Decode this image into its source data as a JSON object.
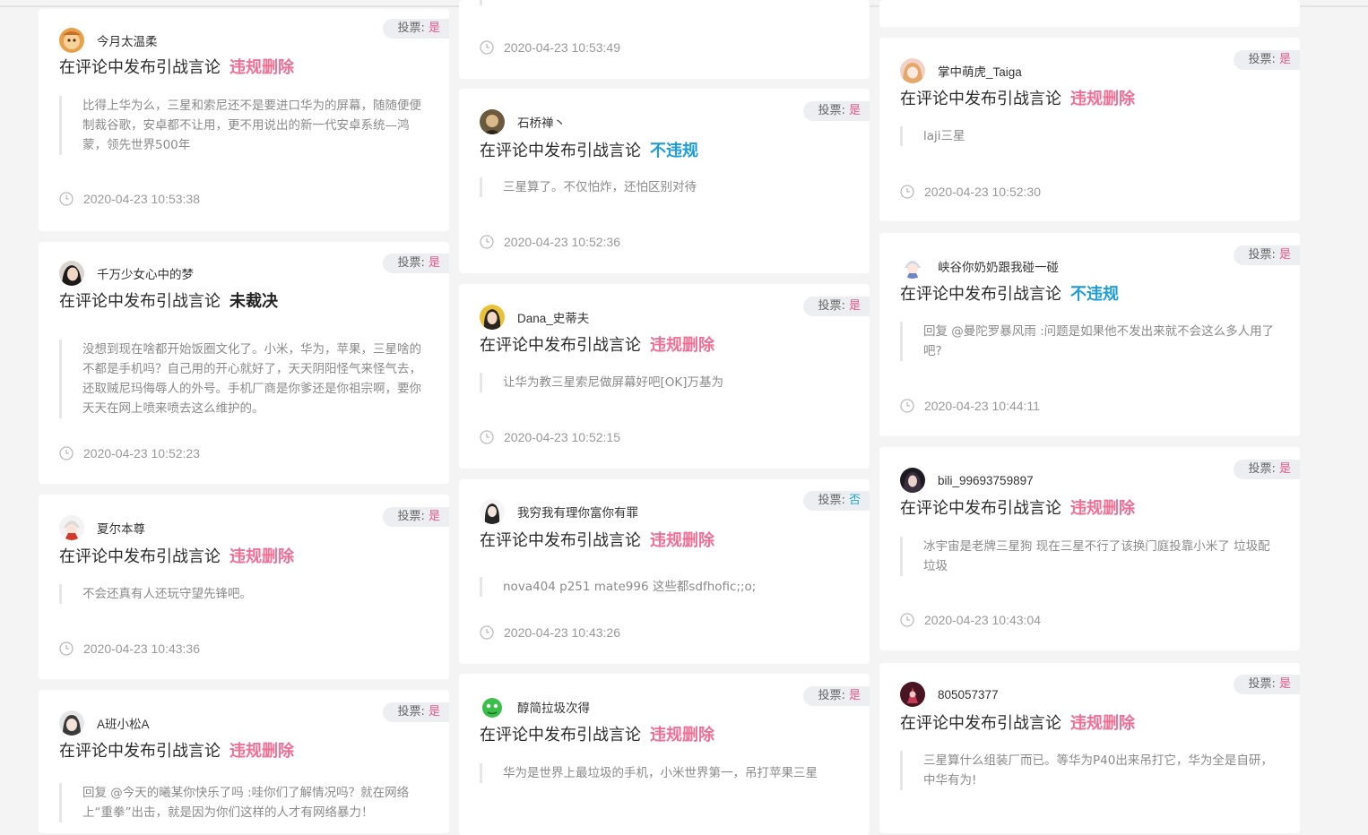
{
  "vote_label": "投票:",
  "title_text": "在评论中发布引战言论",
  "col1": [
    {
      "user": "今月太温柔",
      "vote": "是",
      "verdict": "违规删除",
      "quote": "比得上华为么，三星和索尼还不是要进口华为的屏幕，随随便便制裁谷歌，安卓都不让用，更不用说出的新一代安卓系统—鸿蒙，领先世界500年",
      "time": "2020-04-23 10:53:38"
    },
    {
      "user": "千万少女心中的梦",
      "vote": "是",
      "verdict": "未裁决",
      "quote": "没想到现在啥都开始饭圈文化了。小米，华为，苹果，三星啥的不都是手机吗？自己用的开心就好了，天天阴阳怪气来怪气去，还取贼尼玛侮辱人的外号。手机厂商是你爹还是你祖宗啊，要你天天在网上喷来喷去这么维护的。",
      "time": "2020-04-23 10:52:23"
    },
    {
      "user": "夏尔本尊",
      "vote": "是",
      "verdict": "违规删除",
      "quote": "不会还真有人还玩守望先锋吧。",
      "time": "2020-04-23 10:43:36"
    },
    {
      "user": "A班小松A",
      "vote": "是",
      "verdict": "违规删除",
      "quote": "回复 @今天的曦某你快乐了吗 :哇你们了解情况吗？就在网络上“重拳”出击，就是因为你们这样的人才有网络暴力！",
      "time": ""
    }
  ],
  "col2": [
    {
      "user": "",
      "vote": "",
      "verdict": "",
      "quote": "",
      "time": "2020-04-23 10:53:49"
    },
    {
      "user": "石桥禅丶",
      "vote": "是",
      "verdict": "不违规",
      "quote": "三星算了。不仅怕炸，还怕区别对待",
      "time": "2020-04-23 10:52:36"
    },
    {
      "user": "Dana_史蒂夫",
      "vote": "是",
      "verdict": "违规删除",
      "quote": "让华为教三星索尼做屏幕好吧[OK]万基为",
      "time": "2020-04-23 10:52:15"
    },
    {
      "user": "我穷我有理你富你有罪",
      "vote": "否",
      "verdict": "违规删除",
      "quote": "nova404 p251 mate996 这些都sdfhofic;;o;",
      "time": "2020-04-23 10:43:26"
    },
    {
      "user": "醇简拉圾次得",
      "vote": "是",
      "verdict": "违规删除",
      "quote": "华为是世界上最垃圾的手机，小米世界第一，吊打苹果三星",
      "time": ""
    }
  ],
  "col3": [
    {
      "user": "掌中萌虎_Taiga",
      "vote": "是",
      "verdict": "违规删除",
      "quote": "laji三星",
      "time": "2020-04-23 10:52:30"
    },
    {
      "user": "峡谷你奶奶跟我碰一碰",
      "vote": "是",
      "verdict": "不违规",
      "quote": "回复 @曼陀罗暴风雨 :问题是如果他不发出来就不会这么多人用了吧?",
      "time": "2020-04-23 10:44:11"
    },
    {
      "user": "bili_99693759897",
      "vote": "是",
      "verdict": "违规删除",
      "quote": "冰宇宙是老牌三星狗 现在三星不行了该换门庭投靠小米了 垃圾配垃圾",
      "time": "2020-04-23 10:43:04"
    },
    {
      "user": "805057377",
      "vote": "是",
      "verdict": "违规删除",
      "quote": "三星算什么组装厂而已。等华为P40出来吊打它，华为全是自研，中华有为!",
      "time": ""
    }
  ],
  "colors": {
    "delete": "#ef6f95",
    "ok": "#1d9dd6",
    "vote_yes": "#e9598d",
    "vote_no": "#1fa6cf"
  }
}
